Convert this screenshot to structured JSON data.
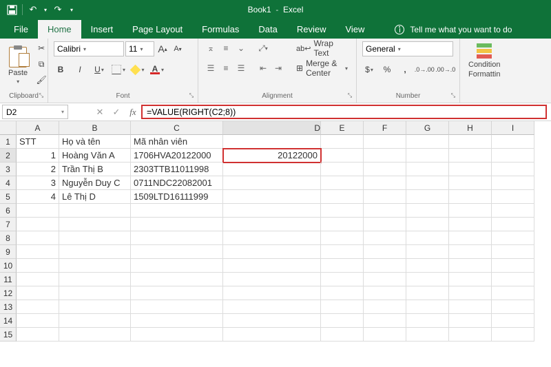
{
  "title": {
    "doc": "Book1",
    "app": "Excel"
  },
  "qat": {
    "save": "save-icon",
    "undo": "undo-icon",
    "redo": "redo-icon"
  },
  "tabs": [
    "File",
    "Home",
    "Insert",
    "Page Layout",
    "Formulas",
    "Data",
    "Review",
    "View"
  ],
  "active_tab": "Home",
  "tell_me": "Tell me what you want to do",
  "ribbon": {
    "clipboard": {
      "paste": "Paste",
      "label": "Clipboard"
    },
    "font": {
      "name": "Calibri",
      "size": "11",
      "bold": "B",
      "italic": "I",
      "underline": "U",
      "label": "Font",
      "bigA": "A",
      "smallA": "A"
    },
    "alignment": {
      "wrap": "Wrap Text",
      "merge": "Merge & Center",
      "label": "Alignment"
    },
    "number": {
      "format": "General",
      "percent": "%",
      "comma": ",",
      "label": "Number",
      "dollar": "$"
    },
    "styles": {
      "cond": "Condition",
      "cond2": "Formattin"
    }
  },
  "formula_bar": {
    "namebox": "D2",
    "formula": "=VALUE(RIGHT(C2;8))",
    "cancel": "✕",
    "enter": "✓",
    "fx": "fx"
  },
  "columns": [
    "A",
    "B",
    "C",
    "D",
    "E",
    "F",
    "G",
    "H",
    "I"
  ],
  "col_widths": [
    "col-A",
    "col-B",
    "col-C",
    "col-D",
    "col-rest",
    "col-rest",
    "col-rest",
    "col-rest",
    "col-rest"
  ],
  "headers": {
    "A": "STT",
    "B": "Họ và tên",
    "C": "Mã nhân viên"
  },
  "rows": [
    {
      "A": "1",
      "B": "Hoàng Văn A",
      "C": "1706HVA20122000",
      "D": "20122000"
    },
    {
      "A": "2",
      "B": "Trần Thị B",
      "C": "2303TTB11011998",
      "D": ""
    },
    {
      "A": "3",
      "B": "Nguyễn Duy C",
      "C": "0711NDC22082001",
      "D": ""
    },
    {
      "A": "4",
      "B": "Lê Thị D",
      "C": "1509LTD16111999",
      "D": ""
    }
  ],
  "selected_cell": "D2",
  "visible_rows": 15
}
